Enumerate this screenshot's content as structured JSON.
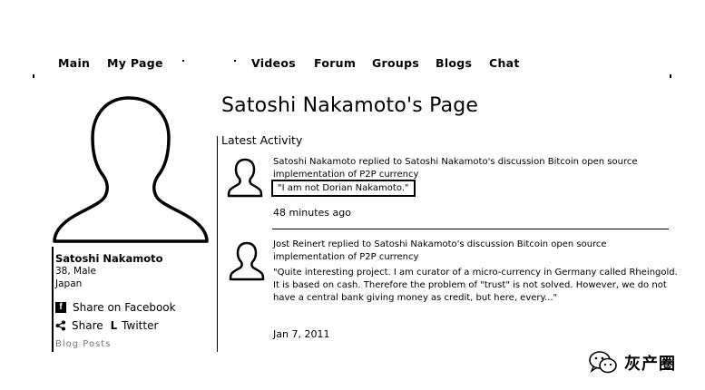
{
  "nav": {
    "items": [
      "Main",
      "My Page",
      "Videos",
      "Forum",
      "Groups",
      "Blogs",
      "Chat"
    ]
  },
  "profile": {
    "name": "Satoshi Nakamoto",
    "age_gender": "38, Male",
    "location": "Japan",
    "share_facebook": "Share on Facebook",
    "share_label": "Share",
    "share_twitter": "Twitter",
    "blog_posts": "Blog Posts"
  },
  "page": {
    "title": "Satoshi Nakamoto's Page",
    "section": "Latest Activity"
  },
  "activity": [
    {
      "headline": "Satoshi Nakamoto replied to Satoshi Nakamoto's discussion Bitcoin open source implementation of P2P currency",
      "quote": "\"I am not Dorian Nakamoto.\"",
      "time": "48 minutes ago"
    },
    {
      "headline": "Jost Reinert replied to Satoshi Nakamoto's discussion Bitcoin open source implementation of P2P currency",
      "quote": "\"Quite interesting project. I am curator of a micro-currency in Germany called Rheingold. It is based on cash. Therefore the problem of \"trust\" is not solved. However, we do not have a central bank giving money as credit, but here, every...\"",
      "time": "Jan 7, 2011"
    }
  ],
  "watermark": {
    "text": "灰产圈",
    "icon": "wechat-icon"
  }
}
